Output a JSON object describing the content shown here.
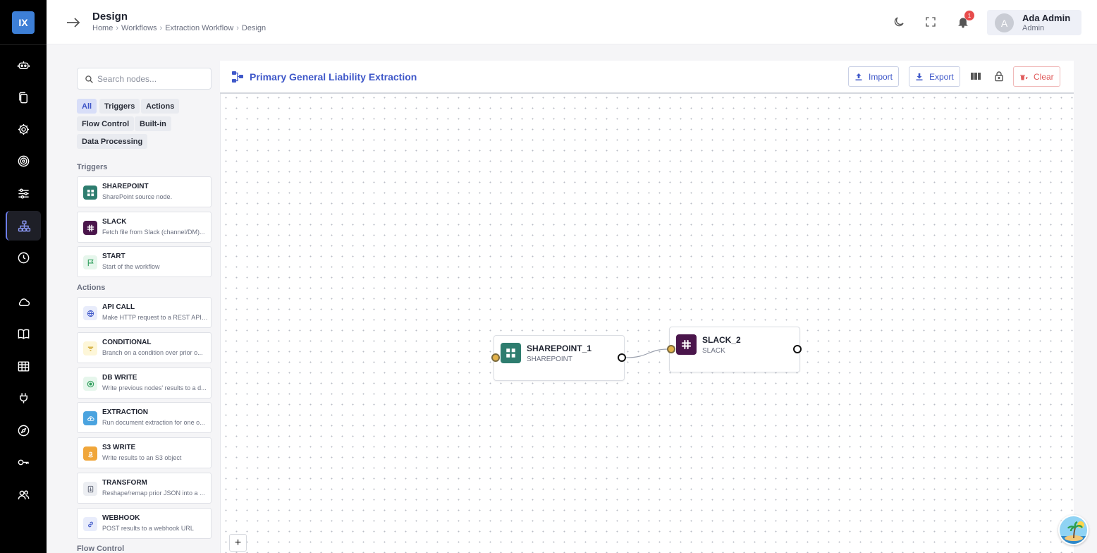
{
  "app": {
    "logo_text": "IX"
  },
  "header": {
    "title": "Design",
    "breadcrumbs": [
      "Home",
      "Workflows",
      "Extraction Workflow",
      "Design"
    ],
    "breadcrumb_separator": "›",
    "notifications_count": "1",
    "user": {
      "initial": "A",
      "name": "Ada Admin",
      "role": "Admin"
    }
  },
  "rail": {
    "items": [
      {
        "icon": "robot-icon"
      },
      {
        "icon": "documents-icon"
      },
      {
        "icon": "settings-gear-icon"
      },
      {
        "icon": "target-icon"
      },
      {
        "icon": "sliders-icon"
      },
      {
        "icon": "workflow-icon",
        "active": true
      },
      {
        "icon": "history-clock-icon"
      },
      {
        "icon": "cloud-icon"
      },
      {
        "icon": "book-icon"
      },
      {
        "icon": "table-icon"
      },
      {
        "icon": "plug-icon"
      },
      {
        "icon": "compass-icon"
      },
      {
        "icon": "key-icon"
      },
      {
        "icon": "users-icon"
      }
    ]
  },
  "palette": {
    "search_placeholder": "Search nodes...",
    "filters": [
      "All",
      "Triggers",
      "Actions",
      "Flow Control",
      "Built-in",
      "Data Processing"
    ],
    "active_filter": "All",
    "sections": {
      "triggers": {
        "label": "Triggers",
        "nodes": [
          {
            "title": "SHAREPOINT",
            "desc": "SharePoint source node.",
            "icon": "sharepoint-icon",
            "color": "#2e7d6f"
          },
          {
            "title": "SLACK",
            "desc": "Fetch file from Slack (channel/DM)...",
            "icon": "slack-icon",
            "color": "#4a154b"
          },
          {
            "title": "START",
            "desc": "Start of the workflow",
            "icon": "flag-icon",
            "color": "#e6f6ec"
          }
        ]
      },
      "actions": {
        "label": "Actions",
        "nodes": [
          {
            "title": "API CALL",
            "desc": "Make HTTP request to a REST API en...",
            "icon": "globe-icon",
            "color": "#e8ecfb"
          },
          {
            "title": "CONDITIONAL",
            "desc": "Branch on a condition over prior o...",
            "icon": "filter-icon",
            "color": "#fdf6d8"
          },
          {
            "title": "DB WRITE",
            "desc": "Write previous nodes' results to a d...",
            "icon": "database-icon",
            "color": "#e6f6ec"
          },
          {
            "title": "EXTRACTION",
            "desc": "Run document extraction for one o...",
            "icon": "cloud-extract-icon",
            "color": "#4aa3df"
          },
          {
            "title": "S3 WRITE",
            "desc": "Write results to an S3 object",
            "icon": "amazon-icon",
            "color": "#f0a63a"
          },
          {
            "title": "TRANSFORM",
            "desc": "Reshape/remap prior JSON into a ...",
            "icon": "transform-icon",
            "color": "#eceef2"
          },
          {
            "title": "WEBHOOK",
            "desc": "POST results to a webhook URL",
            "icon": "link-icon",
            "color": "#e8ecfb"
          }
        ]
      },
      "flow_control": {
        "label": "Flow Control"
      }
    }
  },
  "canvas": {
    "title": "Primary General Liability Extraction",
    "buttons": {
      "import": "Import",
      "export": "Export",
      "clear": "Clear"
    },
    "nodes": [
      {
        "name": "SHAREPOINT_1",
        "type": "SHAREPOINT",
        "icon": "sharepoint-icon",
        "color": "#2e7d6f"
      },
      {
        "name": "SLACK_2",
        "type": "SLACK",
        "icon": "slack-icon",
        "color": "#4a154b"
      }
    ],
    "add_label": "+"
  },
  "colors": {
    "accent": "#3f58c9",
    "danger": "#e05a5a",
    "rail": "#000000"
  }
}
